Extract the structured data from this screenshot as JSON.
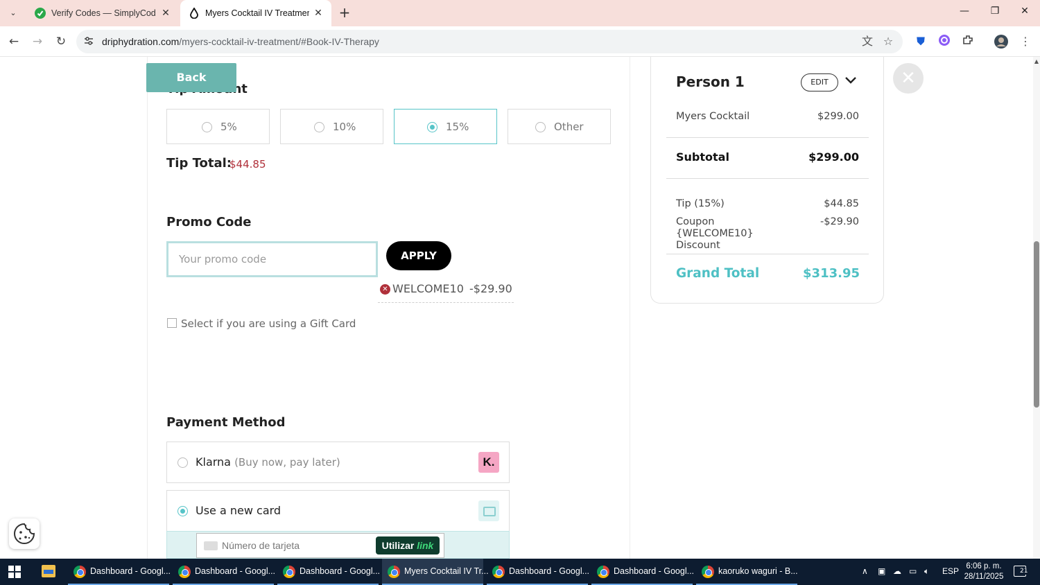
{
  "browser": {
    "tabs": [
      {
        "title": "Verify Codes — SimplyCodes",
        "active": false
      },
      {
        "title": "Myers Cocktail IV Treatment | D",
        "active": true
      }
    ],
    "new_tab": "+",
    "url_host": "driphydration.com",
    "url_path": "/myers-cocktail-iv-treatment/#Book-IV-Therapy"
  },
  "page": {
    "back_label": "Back",
    "tip_heading_partial": "Tip Amount",
    "tip_options": [
      "5%",
      "10%",
      "15%",
      "Other"
    ],
    "tip_selected": "15%",
    "tip_total_label": "Tip Total:",
    "tip_total_value": "$44.85",
    "promo_heading": "Promo Code",
    "promo_placeholder": "Your promo code",
    "apply_label": "APPLY",
    "applied_coupon": {
      "code": "WELCOME10",
      "amount": "-$29.90"
    },
    "gift_card_label": "Select if you are using a Gift Card",
    "payment_heading": "Payment Method",
    "payment_options": [
      {
        "name": "Klarna",
        "sub": "(Buy now, pay later)",
        "logo": "K."
      },
      {
        "name": "Use a new card",
        "sub": ""
      }
    ],
    "card_number_placeholder": "Número de tarjeta",
    "link_button": {
      "prefix": "Utilizar",
      "brand": "link"
    }
  },
  "summary": {
    "person": "Person 1",
    "edit_label": "EDIT",
    "item": {
      "name": "Myers Cocktail",
      "price": "$299.00"
    },
    "subtotal": {
      "label": "Subtotal",
      "value": "$299.00"
    },
    "tip": {
      "label": "Tip (15%)",
      "value": "$44.85"
    },
    "coupon": {
      "label": "Coupon {WELCOME10} Discount",
      "value": "-$29.90"
    },
    "grand_total": {
      "label": "Grand Total",
      "value": "$313.95"
    }
  },
  "taskbar": {
    "apps": [
      {
        "label": "Dashboard - Googl...",
        "active": false
      },
      {
        "label": "Dashboard - Googl...",
        "active": false
      },
      {
        "label": "Dashboard - Googl...",
        "active": false
      },
      {
        "label": "Myers Cocktail IV Tr...",
        "active": true
      },
      {
        "label": "Dashboard - Googl...",
        "active": false
      },
      {
        "label": "Dashboard - Googl...",
        "active": false
      },
      {
        "label": "kaoruko waguri - B...",
        "active": false
      }
    ],
    "language": "ESP",
    "time": "6:06 p. m.",
    "date": "28/11/2025",
    "notifications": "21"
  },
  "colors": {
    "accent_teal": "#56c4c8",
    "back_button": "#6ab5ae",
    "price_red": "#b0303a",
    "grand_total": "#4ec0c4"
  }
}
